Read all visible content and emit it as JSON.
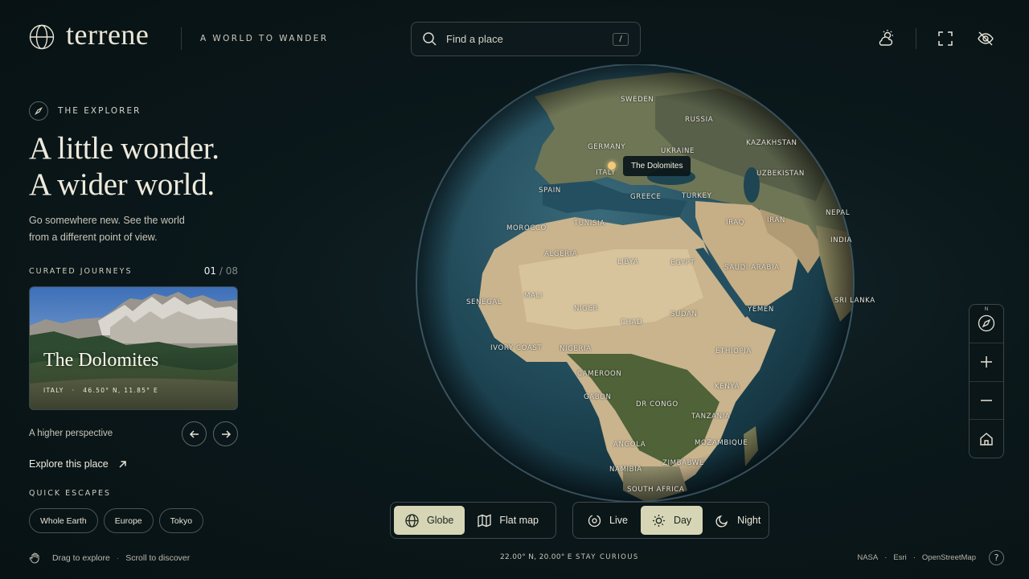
{
  "brand": {
    "name": "terrene",
    "tagline": "A WORLD TO WANDER"
  },
  "search": {
    "placeholder": "Find a place",
    "shortcut": "/"
  },
  "top_icons": [
    "weather-icon",
    "fullscreen-icon",
    "hide-ui-icon"
  ],
  "explorer": {
    "label": "THE EXPLORER",
    "headline_1": "A little wonder.",
    "headline_2": "A wider world.",
    "subtitle": "Go somewhere new. See the world from a different point of view."
  },
  "journeys": {
    "label": "CURATED JOURNEYS",
    "current": "01",
    "total": "/ 08",
    "card": {
      "title": "The Dolomites",
      "country": "ITALY",
      "coords": "46.50° N, 11.85° E"
    },
    "caption": "A higher perspective",
    "explore_label": "Explore this place"
  },
  "quick_escapes": {
    "label": "QUICK ESCAPES",
    "items": [
      "Whole Earth",
      "Europe",
      "Tokyo"
    ]
  },
  "footer": {
    "hint_drag": "Drag to explore",
    "hint_scroll": "Scroll to discover",
    "coords": "22.00° N, 20.00° E",
    "motto": "STAY CURIOUS",
    "credits": [
      "NASA",
      "Esri",
      "OpenStreetMap"
    ],
    "help": "?"
  },
  "map": {
    "tooltip": "The Dolomites",
    "north_label": "N",
    "labels": [
      "SWEDEN",
      "RUSSIA",
      "GERMANY",
      "UKRAINE",
      "KAZAKHSTAN",
      "ITALY",
      "UZBEKISTAN",
      "SPAIN",
      "GREECE",
      "TURKEY",
      "TUNISIA",
      "IRAQ",
      "IRAN",
      "NEPAL",
      "MOROCCO",
      "INDIA",
      "ALGERIA",
      "LIBYA",
      "EGYPT",
      "SAUDI ARABIA",
      "SENEGAL",
      "MALI",
      "SRI LANKA",
      "NIGER",
      "YEMEN",
      "CHAD",
      "SUDAN",
      "IVORY COAST",
      "NIGERIA",
      "ETHIOPIA",
      "CAMEROON",
      "KENYA",
      "GABON",
      "DR CONGO",
      "TANZANIA",
      "ANGOLA",
      "MOZAMBIQUE",
      "ZIMBABWE",
      "NAMIBIA",
      "SOUTH AFRICA"
    ]
  },
  "view_toggle": {
    "globe": "Globe",
    "flat": "Flat map",
    "active": "Globe"
  },
  "time_toggle": {
    "live": "Live",
    "day": "Day",
    "night": "Night",
    "active": "Day"
  }
}
